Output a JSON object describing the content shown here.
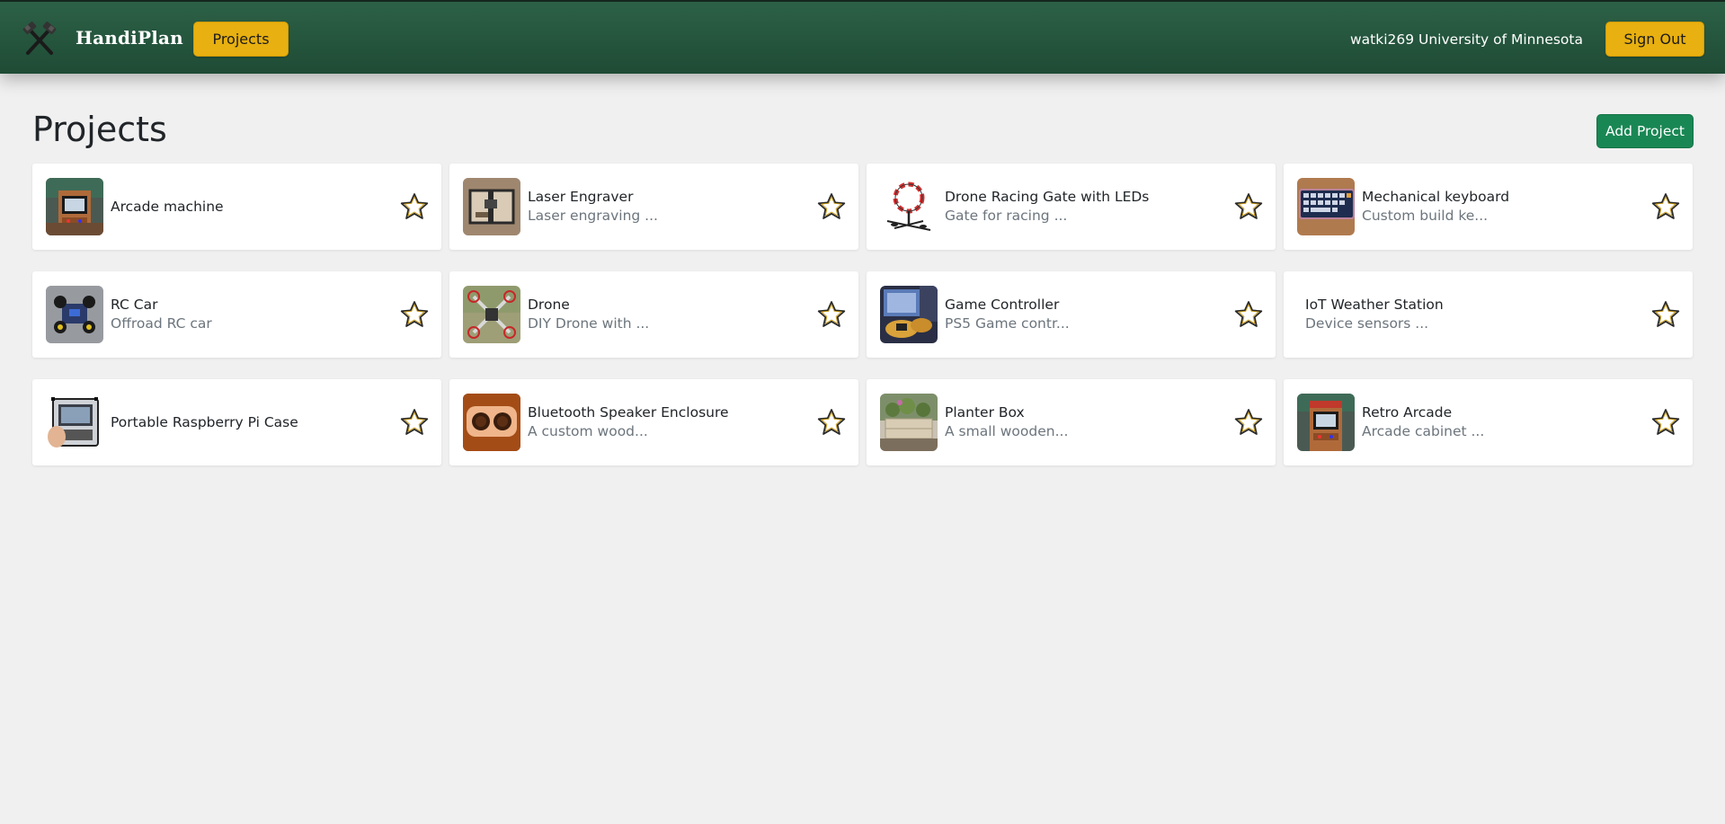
{
  "header": {
    "brand": "HandiPlan",
    "nav_projects": "Projects",
    "user": "watki269 University of Minnesota",
    "sign_out": "Sign Out",
    "logo_icon": "crossed-hammers-icon"
  },
  "main": {
    "title": "Projects",
    "add_project": "Add Project"
  },
  "projects": [
    {
      "title": "Arcade machine",
      "desc": "",
      "thumb": "arcade-machine-photo"
    },
    {
      "title": "Laser Engraver",
      "desc": "Laser engraving ...",
      "thumb": "laser-engraver-photo"
    },
    {
      "title": "Drone Racing Gate with LEDs",
      "desc": "Gate for racing ...",
      "thumb": "drone-gate-photo"
    },
    {
      "title": "Mechanical keyboard",
      "desc": "Custom build ke...",
      "thumb": "keyboard-photo"
    },
    {
      "title": "RC Car",
      "desc": "Offroad RC car",
      "thumb": "rc-car-photo"
    },
    {
      "title": "Drone",
      "desc": "DIY Drone with ...",
      "thumb": "drone-photo"
    },
    {
      "title": "Game Controller",
      "desc": "PS5 Game contr...",
      "thumb": "game-controller-photo"
    },
    {
      "title": "IoT Weather Station",
      "desc": "Device sensors ...",
      "thumb": ""
    },
    {
      "title": "Portable Raspberry Pi Case",
      "desc": "",
      "thumb": "raspberry-pi-case-photo"
    },
    {
      "title": "Bluetooth Speaker Enclosure",
      "desc": "A custom wood...",
      "thumb": "speaker-enclosure-photo"
    },
    {
      "title": "Planter Box",
      "desc": "A small wooden...",
      "thumb": "planter-box-photo"
    },
    {
      "title": "Retro Arcade",
      "desc": "Arcade cabinet ...",
      "thumb": "retro-arcade-photo"
    }
  ],
  "colors": {
    "header_bg": "#245a40",
    "accent_yellow": "#e8b010",
    "success_green": "#198754",
    "page_bg": "#f0f0f0",
    "star_fill": "#ffffff",
    "star_stroke": "#2b2b2b"
  },
  "icons": {
    "favorite": "star-outline-icon"
  }
}
